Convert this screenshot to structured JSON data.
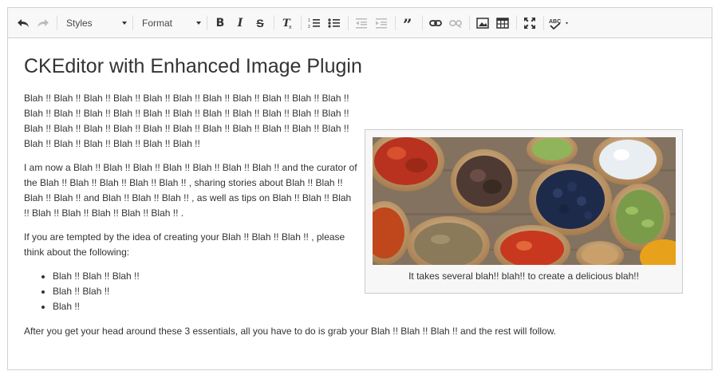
{
  "toolbar": {
    "styles_label": "Styles",
    "format_label": "Format",
    "spellcheck_label": "ABC"
  },
  "document": {
    "title": "CKEditor with Enhanced Image Plugin",
    "paragraphs": [
      "Blah !! Blah !! Blah !! Blah !! Blah !! Blah !! Blah !! Blah !! Blah !! Blah !! Blah !! Blah !! Blah !! Blah !! Blah !! Blah !! Blah !! Blah !! Blah !! Blah !! Blah !! Blah !! Blah !! Blah !! Blah !! Blah !! Blah !! Blah !! Blah !! Blah !! Blah !! Blah !! Blah !! Blah !! Blah !! Blah !! Blah !! Blah !! Blah !!",
      "I am now a Blah !! Blah !! Blah !! Blah !! Blah !! Blah !! Blah !!  and the curator of the Blah !! Blah !! Blah !! Blah !! Blah !! , sharing stories about Blah !! Blah !! Blah !! Blah !! and Blah !! Blah !! Blah !! , as well as tips on Blah !! Blah !! Blah !! Blah !! Blah !! Blah !! Blah !! Blah !! .",
      "If you are tempted by the idea of creating your Blah !! Blah !! Blah !! , please think about the following:"
    ],
    "list_items": [
      "Blah !! Blah !! Blah !!",
      "Blah !! Blah !!",
      "Blah !!"
    ],
    "closing": "After you get your head around these 3 essentials, all you have to do is grab your Blah !! Blah !! Blah !! and the rest will follow."
  },
  "figure": {
    "caption": "It takes several blah!! blah!! to create a delicious blah!!"
  },
  "colors": {
    "toolbar_bg": "#f8f8f8",
    "border": "#d1d1d1",
    "text": "#333333",
    "figure_bg": "#f7f7f7"
  }
}
